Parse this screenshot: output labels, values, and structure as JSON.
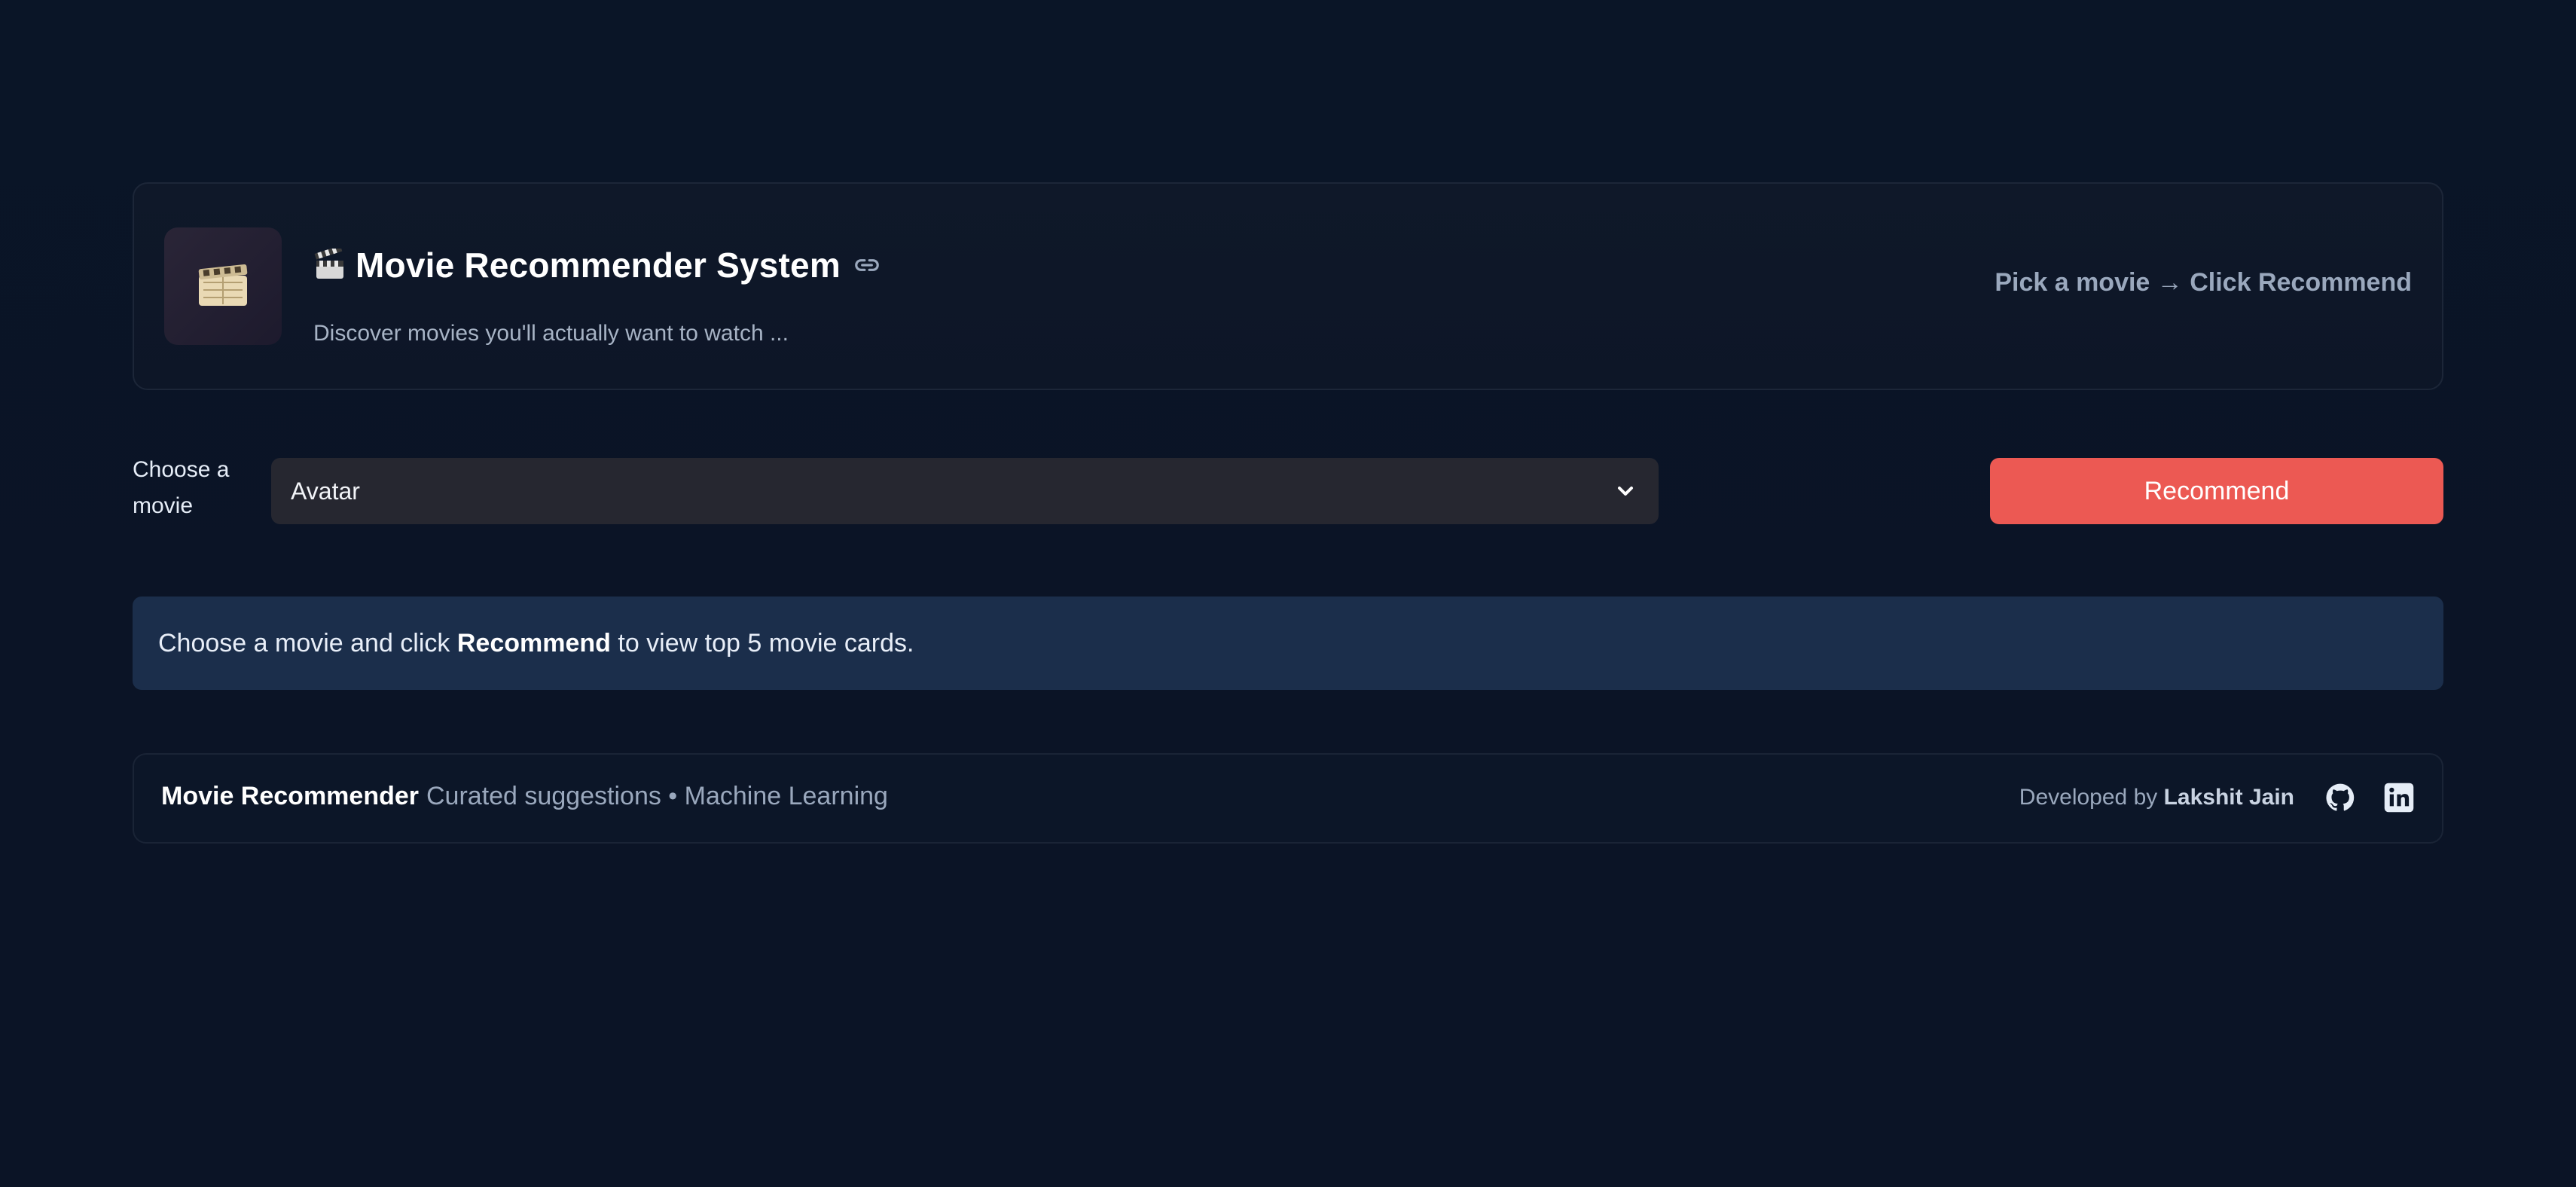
{
  "header": {
    "title": "Movie Recommender System",
    "subtitle": "Discover movies you'll actually want to watch ...",
    "hint": "Pick a movie → Click Recommend",
    "icons": [
      "film-reel-icon",
      "clapperboard-icon",
      "link-icon"
    ]
  },
  "controls": {
    "select_label": "Choose a movie",
    "selected_movie": "Avatar",
    "recommend_label": "Recommend"
  },
  "info": {
    "prefix": "Choose a movie and click ",
    "emphasis": "Recommend",
    "suffix": " to view top 5 movie cards."
  },
  "footer": {
    "brand": "Movie Recommender",
    "tagline": "Curated suggestions • Machine Learning",
    "developed_by_prefix": "Developed by ",
    "developer": "Lakshit Jain",
    "icons": [
      "github-icon",
      "linkedin-icon"
    ]
  },
  "colors": {
    "background": "#0b1426",
    "accent": "#ec5953",
    "info_bg": "#1b2e4b",
    "select_bg": "#262730"
  }
}
